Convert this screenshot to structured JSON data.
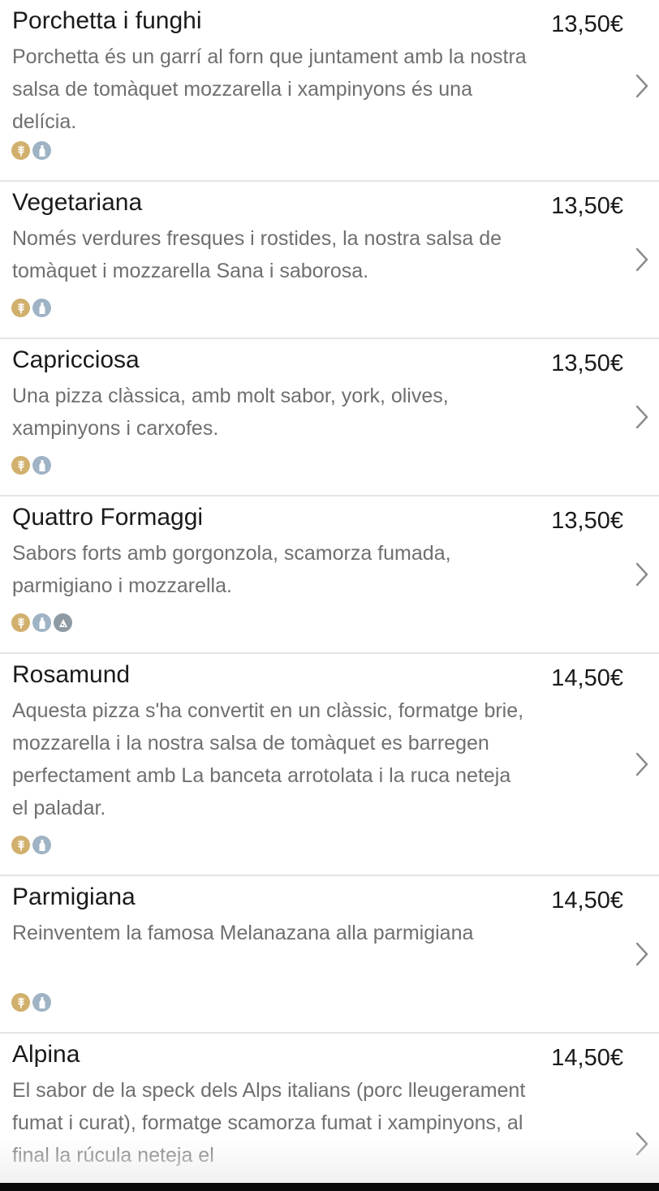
{
  "menu": {
    "items": [
      {
        "name": "Porchetta i funghi",
        "price": "13,50€",
        "description": "Porchetta és un garrí al forn que juntament amb la nostra salsa de tomàquet mozzarella i xampinyons és una delícia.",
        "allergens": [
          "gluten-icon",
          "milk-icon"
        ]
      },
      {
        "name": "Vegetariana",
        "price": "13,50€",
        "description": "Només verdures fresques i rostides, la nostra salsa de tomàquet i mozzarella Sana i saborosa.",
        "allergens": [
          "gluten-icon",
          "milk-icon"
        ]
      },
      {
        "name": "Capricciosa",
        "price": "13,50€",
        "description": "Una pizza clàssica, amb molt sabor, york, olives, xampinyons i carxofes.",
        "allergens": [
          "gluten-icon",
          "milk-icon"
        ]
      },
      {
        "name": "Quattro Formaggi",
        "price": "13,50€",
        "description": "Sabors forts amb gorgonzola, scamorza fumada, parmigiano i mozzarella.",
        "allergens": [
          "gluten-icon",
          "milk-icon",
          "dairy-icon"
        ]
      },
      {
        "name": "Rosamund",
        "price": "14,50€",
        "description": "Aquesta pizza s'ha convertit en un clàssic, formatge brie, mozzarella i la nostra salsa de tomàquet es barregen perfectament amb La banceta arrotolata i la ruca neteja el paladar.",
        "allergens": [
          "gluten-icon",
          "milk-icon"
        ]
      },
      {
        "name": "Parmigiana",
        "price": "14,50€",
        "description": "Reinventem la famosa Melanazana alla parmigiana",
        "allergens": [
          "gluten-icon",
          "milk-icon"
        ]
      },
      {
        "name": "Alpina",
        "price": "14,50€",
        "description": "El sabor de la speck dels Alps italians (porc lleugerament fumat i curat), formatge scamorza fumat i xampinyons, al final la rúcula neteja el",
        "allergens": []
      }
    ]
  },
  "colors": {
    "gluten": "#d1b06d",
    "milk": "#9fb3c5",
    "dairy": "#8e9aa3",
    "text": "#1a1a1a",
    "description": "#6f6f6f",
    "divider": "#e4e4e4",
    "chevron": "#8a8a8a"
  }
}
